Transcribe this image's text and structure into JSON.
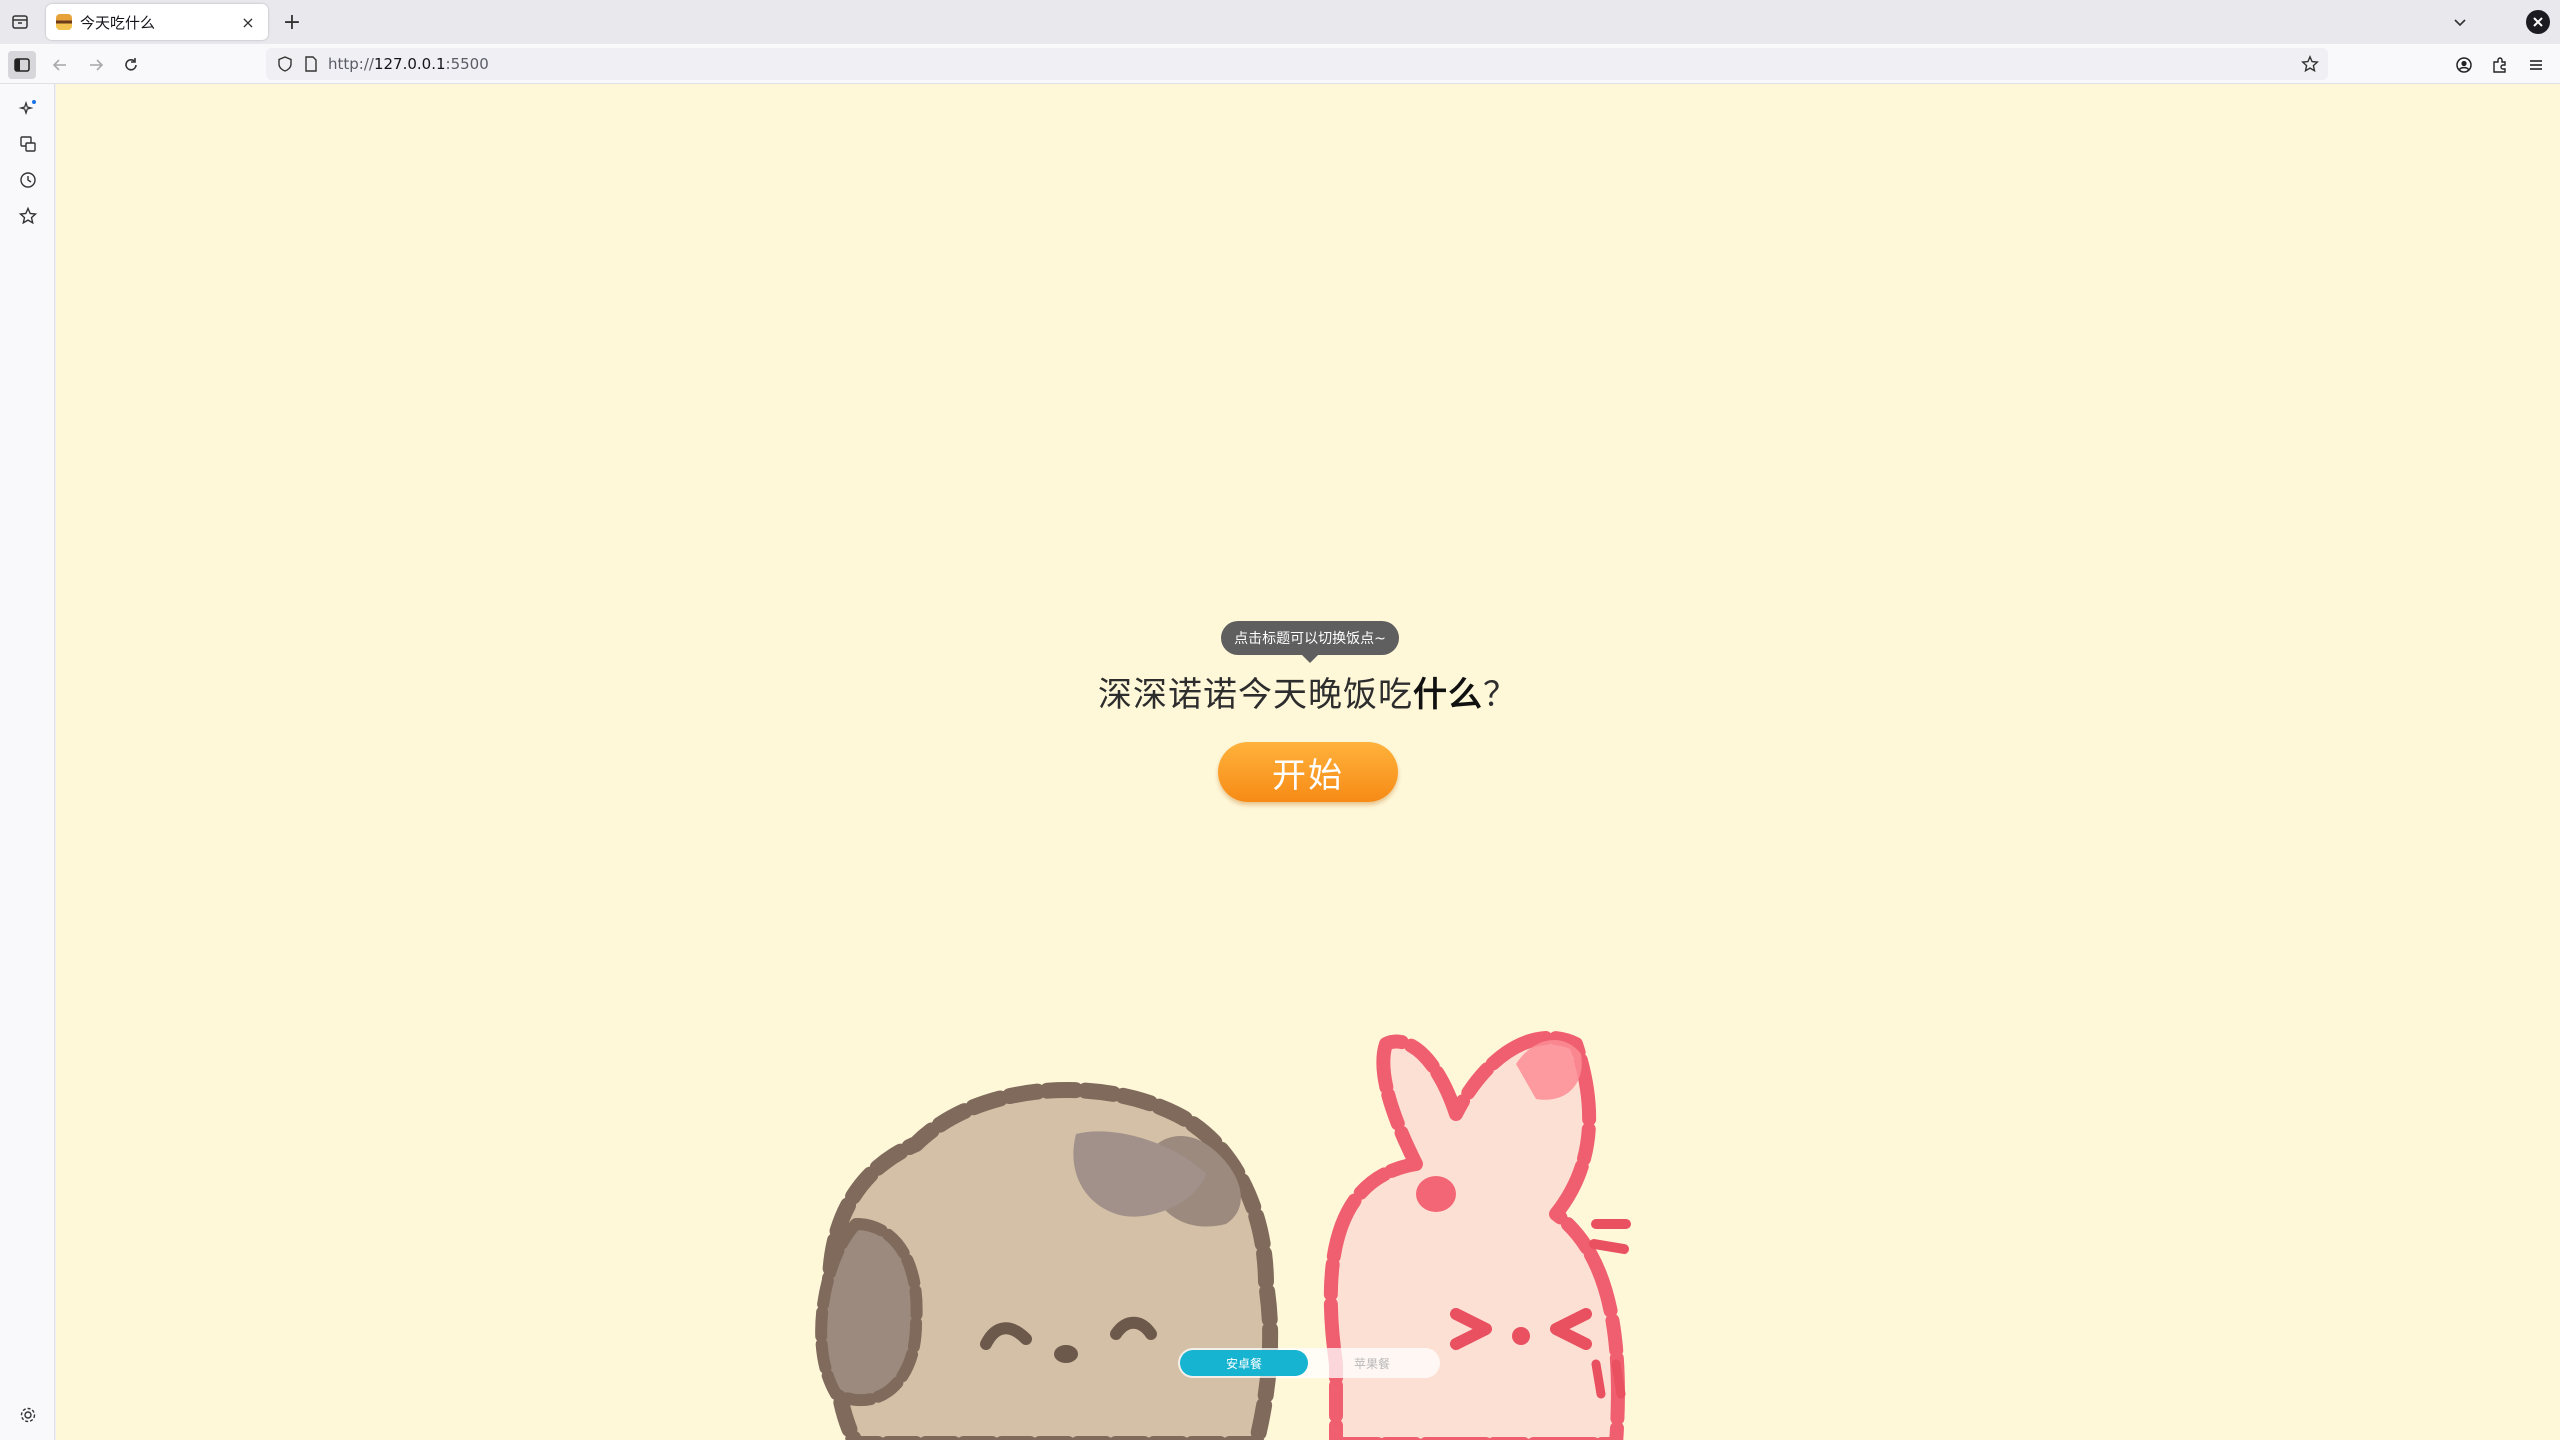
{
  "browser": {
    "tab": {
      "title": "今天吃什么",
      "close_label": "×"
    },
    "new_tab_label": "+",
    "url": {
      "scheme": "http://",
      "host": "127.0.0.1",
      "port": ":5500"
    }
  },
  "page": {
    "tooltip": "点击标题可以切换饭点~",
    "headline": {
      "prefix": "深深诺诺今天晚饭吃",
      "emphasis": "什么",
      "suffix": "？"
    },
    "start_button": "开始",
    "toggle": {
      "active": "安卓餐",
      "inactive": "苹果餐"
    }
  },
  "colors": {
    "page_bg": "#fef8d9",
    "button_orange": "#f68b16",
    "toggle_active": "#16b4d0",
    "tooltip_bg": "#5f5f5f"
  }
}
